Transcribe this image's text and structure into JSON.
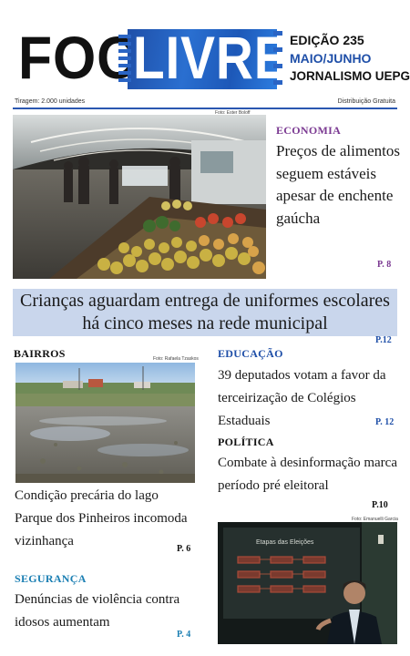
{
  "masthead": {
    "logo_left": "FOCA",
    "logo_right": "LIVRE",
    "edition": "EDIÇÃO 235",
    "months": "MAIO/JUNHO",
    "publisher": "JORNALISMO UEPG",
    "print_run": "Tiragem: 2.000 unidades",
    "distribution": "Distribuição Gratuita"
  },
  "economia": {
    "photo_credit": "Foto: Ester Boloff",
    "section": "ECONOMIA",
    "headline": "Preços de alimentos seguem estáveis apesar de enchente gaúcha",
    "page": "P. 8"
  },
  "banner": {
    "headline": "Crianças aguardam entrega de uniformes escolares há cinco meses na rede municipal",
    "page": "P.12"
  },
  "bairros": {
    "section": "BAIRROS",
    "photo_credit": "Foto: Rafaela Tzaskos",
    "headline": "Condição precária do lago Parque dos Pinheiros incomoda vizinhança",
    "page": "P. 6"
  },
  "educacao": {
    "section": "EDUCAÇÃO",
    "headline": "39 deputados votam a favor da terceirização de Colégios Estaduais",
    "page": "P. 12"
  },
  "politica": {
    "section": "POLÍTICA",
    "headline": "Combate à desinformação marca período pré eleitoral",
    "page": "P.10",
    "photo_credit": "Foto: Emanuelli Garcia",
    "slide_title": "Etapas das Eleições"
  },
  "seguranca": {
    "section": "SEGURANÇA",
    "headline": "Denúncias de violência contra idosos aumentam",
    "page": "P. 4"
  },
  "colors": {
    "accent_blue": "#1f4fa8",
    "economia_purple": "#7b3a92",
    "seguranca_teal": "#1b7fb3",
    "banner_bg": "#c9d6ec"
  }
}
